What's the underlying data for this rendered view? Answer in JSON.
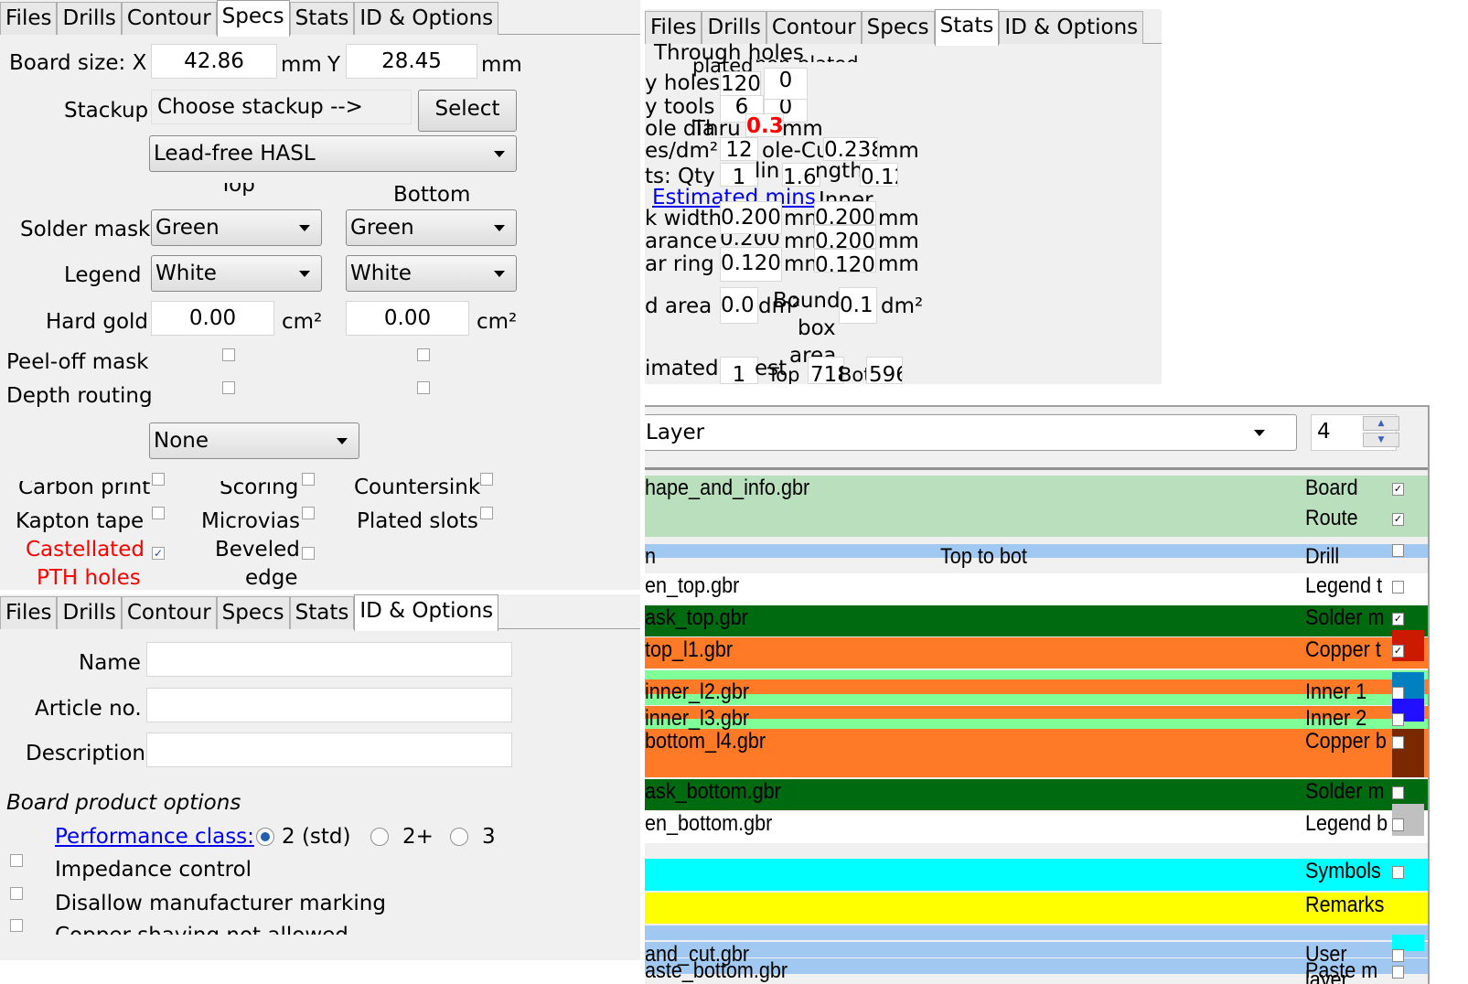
{
  "tabs": [
    "Files",
    "Drills",
    "Contour",
    "Specs",
    "Stats",
    "ID & Options"
  ],
  "specs": {
    "board_size_label": "Board size: X",
    "x_value": "42.86",
    "mm1": "mm",
    "y_label": "Y",
    "y_value": "28.45",
    "mm2": "mm",
    "stackup_label": "Stackup",
    "stackup_value": "Choose stackup -->",
    "select_label": "Select",
    "finish_value": "Lead-free HASL",
    "top_header": "Top",
    "bottom_header": "Bottom",
    "solder_mask_label": "Solder mask",
    "solder_top": "Green",
    "solder_bottom": "Green",
    "legend_label": "Legend",
    "legend_top": "White",
    "legend_bottom": "White",
    "hard_gold_label": "Hard gold",
    "gold_top": "0.00",
    "gold_bottom": "0.00",
    "cm2": "cm²",
    "peel_label": "Peel-off mask",
    "depth_label": "Depth routing",
    "none_value": "None",
    "carbon": "Carbon print",
    "scoring": "Scoring",
    "countersink": "Countersink",
    "kapton": "Kapton tape",
    "microvias": "Microvias",
    "plated_slots": "Plated slots",
    "castellated": "Castellated",
    "pth": "PTH holes",
    "beveled": "Beveled",
    "edge": "edge",
    "castellated_color": "#ff0000"
  },
  "idopts": {
    "name_label": "Name",
    "article_label": "Article no.",
    "desc_label": "Description",
    "section": "Board product options",
    "perf_link": "Performance class:",
    "perf_options": [
      "2 (std)",
      "2+",
      "3"
    ],
    "perf_selected": "2 (std)",
    "impedance": "Impedance control",
    "disallow": "Disallow manufacturer marking",
    "copper": "Copper shaving not allowed"
  },
  "stats": {
    "through": "Through holes",
    "plated": "plated",
    "nonplated": "non-plated",
    "holes_label": "y holes",
    "holes": "120",
    "holes_np": "0",
    "tools_label": "y tools",
    "tools": "6",
    "tools_np": "0",
    "hole_dia_label": "ole dia",
    "thru": "Thru",
    "min_hole": "0.3",
    "mm": "mm",
    "dens_label": "es/dm²",
    "dens": "12",
    "hole_cu": "ole-Cu",
    "hole_cu_val": "0.238",
    "mm2": "mm",
    "slots_label": "ts: Qty",
    "slots_qty": "1",
    "min": "lin",
    "min_val": "1.6",
    "length": "ngth",
    "length_val": "0.12",
    "est_link": "Estimated mins",
    "inner": "Inner",
    "width_label": "k width",
    "width_outer": "0.200",
    "width_inner": "0.200",
    "clear_label": "arance",
    "clear_outer": "0.200",
    "clear_inner": "0.200",
    "ring_label": "ar ring",
    "ring_outer": "0.120",
    "ring_inner": "0.120",
    "mmu": "mm",
    "area_label": "d area",
    "area": "0.0",
    "dm2": "dm²",
    "bound": "Bound",
    "box": "box",
    "area2": "area",
    "bound_val": "0.1",
    "est_label": "imated",
    "est_val": "1",
    "est2": "est",
    "top_lbl": "Top",
    "top_val": "718",
    "bot_lbl": "Bot",
    "bot_val": "596"
  },
  "layers": {
    "combo_value": "Layer",
    "count": "4",
    "rows": [
      {
        "file": "hape_and_info.gbr",
        "type": "Board",
        "checked": true,
        "color": "#b9dfbd"
      },
      {
        "file": "",
        "type": "Route",
        "checked": true,
        "color": "#b9dfbd"
      },
      {
        "file": "n",
        "span": "Top to bot",
        "type": "Drill",
        "checked": false,
        "color": "#a0c8f0"
      },
      {
        "file": "en_top.gbr",
        "type": "Legend t",
        "checked": false,
        "color": "#ffffff"
      },
      {
        "file": "ask_top.gbr",
        "type": "Solder m",
        "checked": true,
        "color": "#006a10"
      },
      {
        "file": "top_l1.gbr",
        "type": "Copper t",
        "checked": true,
        "color": "#ff7a26",
        "swatch": "#cc1a00"
      },
      {
        "file": "inner_l2.gbr",
        "type": "Inner 1",
        "checked": false,
        "color": "#ff7a26",
        "swatch": "#0080c0"
      },
      {
        "file": "inner_l3.gbr",
        "type": "Inner 2",
        "checked": false,
        "color": "#ff7a26",
        "swatch": "#2010ff"
      },
      {
        "file": "bottom_l4.gbr",
        "type": "Copper b",
        "checked": false,
        "color": "#ff7a26",
        "swatch": "#7a2800"
      },
      {
        "file": "ask_bottom.gbr",
        "type": "Solder m",
        "checked": false,
        "color": "#006a10"
      },
      {
        "file": "en_bottom.gbr",
        "type": "Legend b",
        "checked": false,
        "color": "#ffffff",
        "swatch": "#c0c0c0"
      },
      {
        "file": "",
        "type": "Symbols",
        "checked": false,
        "color": "#00ffff"
      },
      {
        "file": "",
        "type": "Remarks",
        "checked": null,
        "color": "#ffff00"
      },
      {
        "file": "and_cut.gbr",
        "type": "User layer",
        "checked": false,
        "color": "#a0c8f0",
        "swatch": "#00ffff"
      },
      {
        "file": "aste_bottom.gbr",
        "type": "Paste m",
        "checked": false,
        "color": "#a0c8f0"
      }
    ]
  }
}
